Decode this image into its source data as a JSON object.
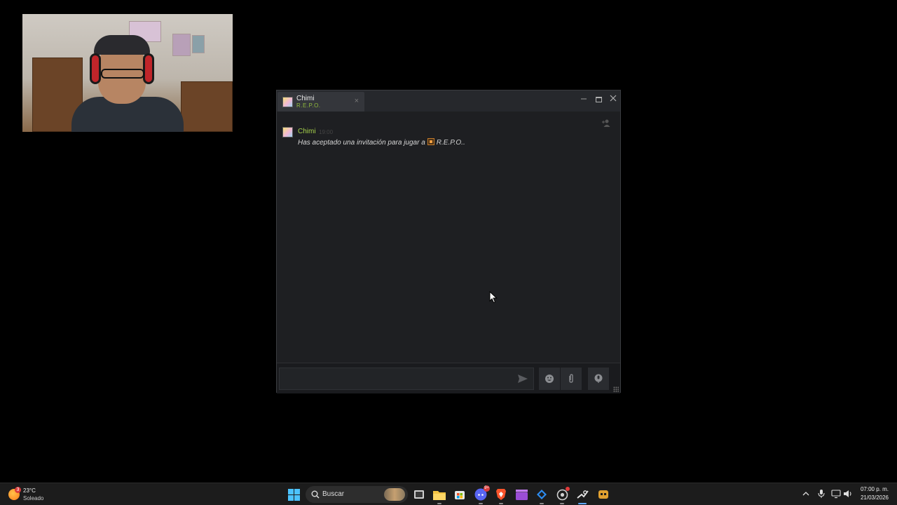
{
  "chat": {
    "tab_name": "Chimi",
    "tab_game": "R.E.P.O.",
    "tab_close": "×",
    "message": {
      "sender": "Chimi",
      "time": "19:00",
      "text_prefix": "Has aceptado una invitación para jugar a",
      "game": "R.E.P.O."
    },
    "input_value": ""
  },
  "taskbar": {
    "weather_temp": "23°C",
    "weather_desc": "Soleado",
    "weather_badge": "3",
    "search_label": "Buscar",
    "discord_badge": "9+",
    "clock_time": "07:00 p. m.",
    "clock_date": "21/03/2026"
  },
  "colors": {
    "steam_green": "#90ba3c",
    "chat_bg": "#1e1f22",
    "taskbar_bg": "#1c1c1c",
    "active_indicator": "#5ea8ff"
  },
  "icons": [
    "add-friend-icon",
    "send-icon",
    "emoji-icon",
    "attach-icon",
    "voice-icon",
    "windows-start-icon",
    "search-icon",
    "task-view-icon",
    "file-explorer-icon",
    "store-icon",
    "discord-icon",
    "brave-icon",
    "clapper-icon",
    "vscode-icon",
    "chrome-icon",
    "steam-icon",
    "game-icon",
    "mic-icon",
    "network-icon",
    "volume-icon",
    "weather-icon"
  ]
}
